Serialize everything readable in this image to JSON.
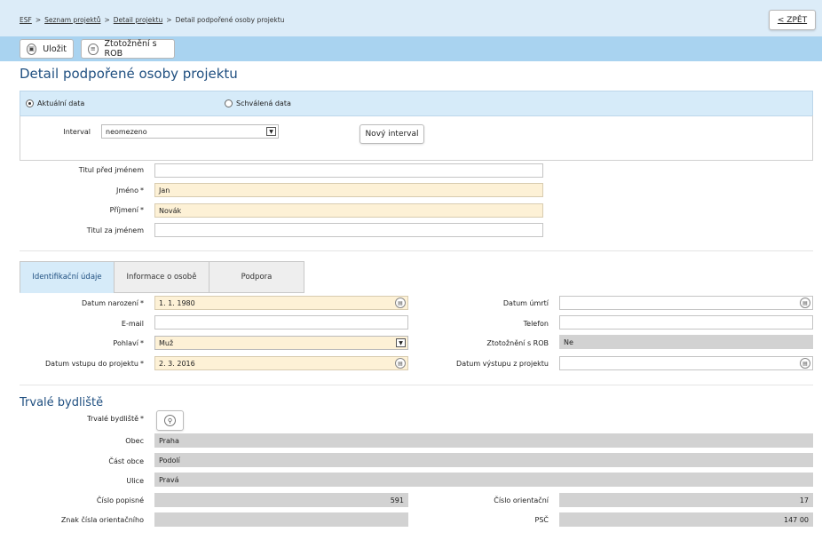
{
  "breadcrumb": {
    "items": [
      "ESF",
      "Seznam projektů",
      "Detail projektu"
    ],
    "current": "Detail podpořené osoby projektu",
    "sep": ">"
  },
  "header": {
    "back_label": "< ZPĚT"
  },
  "toolbar": {
    "save_label": "Uložit",
    "rob_label": "Ztotožnění s ROB"
  },
  "page_title": "Detail podpořené osoby projektu",
  "data_mode": {
    "current_label": "Aktuální data",
    "approved_label": "Schválená data",
    "selected": "current"
  },
  "interval": {
    "label": "Interval",
    "value": "neomezeno",
    "new_button": "Nový interval"
  },
  "name_fields": {
    "title_before": {
      "label": "Titul před jménem",
      "value": ""
    },
    "first_name": {
      "label": "Jméno",
      "value": "Jan"
    },
    "last_name": {
      "label": "Příjmení",
      "value": "Novák"
    },
    "title_after": {
      "label": "Titul za jménem",
      "value": ""
    },
    "required_mark": "*"
  },
  "tabs": [
    "Identifikační údaje",
    "Informace o osobě",
    "Podpora"
  ],
  "identification": {
    "birth_date": {
      "label": "Datum narození",
      "value": "1. 1. 1980"
    },
    "death_date": {
      "label": "Datum úmrtí",
      "value": ""
    },
    "email": {
      "label": "E-mail",
      "value": ""
    },
    "phone": {
      "label": "Telefon",
      "value": ""
    },
    "gender": {
      "label": "Pohlaví",
      "value": "Muž"
    },
    "rob": {
      "label": "Ztotožnění s ROB",
      "value": "Ne"
    },
    "entry_date": {
      "label": "Datum vstupu do projektu",
      "value": "2. 3. 2016"
    },
    "exit_date": {
      "label": "Datum výstupu z projektu",
      "value": ""
    }
  },
  "residence": {
    "title": "Trvalé bydliště",
    "address_label": "Trvalé bydliště",
    "city": {
      "label": "Obec",
      "value": "Praha"
    },
    "district": {
      "label": "Část obce",
      "value": "Podolí"
    },
    "street": {
      "label": "Ulice",
      "value": "Pravá"
    },
    "house_no": {
      "label": "Číslo popisné",
      "value": "591"
    },
    "orient_no": {
      "label": "Číslo orientační",
      "value": "17"
    },
    "orient_sign": {
      "label": "Znak čísla orientačního",
      "value": ""
    },
    "zip": {
      "label": "PSČ",
      "value": "147 00"
    }
  },
  "colors": {
    "accent": "#1f4f80",
    "toolbar": "#a9d3f0",
    "header": "#dcecf8",
    "required_field": "#fdf1d6",
    "readonly_field": "#d2d2d2"
  }
}
